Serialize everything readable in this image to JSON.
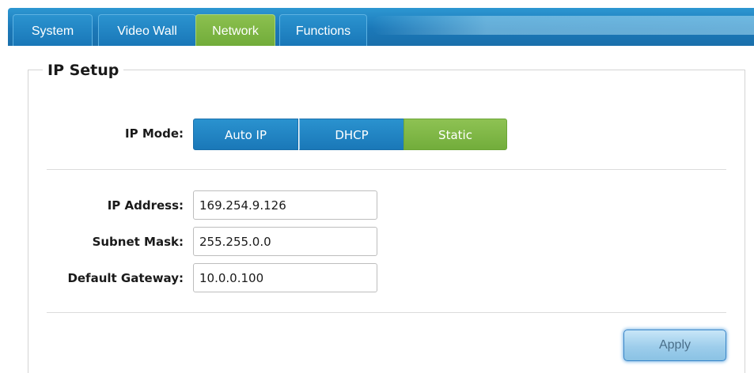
{
  "tabs": [
    {
      "label": "System",
      "active": false
    },
    {
      "label": "Video Wall",
      "active": false
    },
    {
      "label": "Network",
      "active": true
    },
    {
      "label": "Functions",
      "active": false
    }
  ],
  "section": {
    "title": "IP Setup"
  },
  "ip_mode": {
    "label": "IP Mode:",
    "options": [
      "Auto IP",
      "DHCP",
      "Static"
    ],
    "selected": "Static"
  },
  "fields": {
    "ip_address": {
      "label": "IP Address:",
      "value": "169.254.9.126"
    },
    "subnet_mask": {
      "label": "Subnet Mask:",
      "value": "255.255.0.0"
    },
    "default_gateway": {
      "label": "Default Gateway:",
      "value": "10.0.0.100"
    }
  },
  "actions": {
    "apply_label": "Apply"
  },
  "colors": {
    "tab_blue": "#1a78b8",
    "active_green": "#72ad3b",
    "apply_light_blue": "#9dcdeb"
  }
}
